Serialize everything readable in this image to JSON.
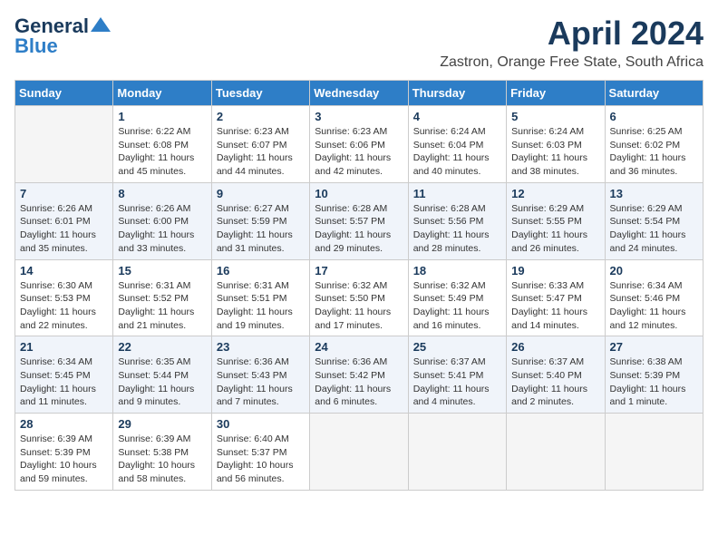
{
  "logo": {
    "general": "General",
    "blue": "Blue"
  },
  "title": "April 2024",
  "location": "Zastron, Orange Free State, South Africa",
  "weekdays": [
    "Sunday",
    "Monday",
    "Tuesday",
    "Wednesday",
    "Thursday",
    "Friday",
    "Saturday"
  ],
  "weeks": [
    [
      {
        "day": "",
        "info": ""
      },
      {
        "day": "1",
        "info": "Sunrise: 6:22 AM\nSunset: 6:08 PM\nDaylight: 11 hours and 45 minutes."
      },
      {
        "day": "2",
        "info": "Sunrise: 6:23 AM\nSunset: 6:07 PM\nDaylight: 11 hours and 44 minutes."
      },
      {
        "day": "3",
        "info": "Sunrise: 6:23 AM\nSunset: 6:06 PM\nDaylight: 11 hours and 42 minutes."
      },
      {
        "day": "4",
        "info": "Sunrise: 6:24 AM\nSunset: 6:04 PM\nDaylight: 11 hours and 40 minutes."
      },
      {
        "day": "5",
        "info": "Sunrise: 6:24 AM\nSunset: 6:03 PM\nDaylight: 11 hours and 38 minutes."
      },
      {
        "day": "6",
        "info": "Sunrise: 6:25 AM\nSunset: 6:02 PM\nDaylight: 11 hours and 36 minutes."
      }
    ],
    [
      {
        "day": "7",
        "info": "Sunrise: 6:26 AM\nSunset: 6:01 PM\nDaylight: 11 hours and 35 minutes."
      },
      {
        "day": "8",
        "info": "Sunrise: 6:26 AM\nSunset: 6:00 PM\nDaylight: 11 hours and 33 minutes."
      },
      {
        "day": "9",
        "info": "Sunrise: 6:27 AM\nSunset: 5:59 PM\nDaylight: 11 hours and 31 minutes."
      },
      {
        "day": "10",
        "info": "Sunrise: 6:28 AM\nSunset: 5:57 PM\nDaylight: 11 hours and 29 minutes."
      },
      {
        "day": "11",
        "info": "Sunrise: 6:28 AM\nSunset: 5:56 PM\nDaylight: 11 hours and 28 minutes."
      },
      {
        "day": "12",
        "info": "Sunrise: 6:29 AM\nSunset: 5:55 PM\nDaylight: 11 hours and 26 minutes."
      },
      {
        "day": "13",
        "info": "Sunrise: 6:29 AM\nSunset: 5:54 PM\nDaylight: 11 hours and 24 minutes."
      }
    ],
    [
      {
        "day": "14",
        "info": "Sunrise: 6:30 AM\nSunset: 5:53 PM\nDaylight: 11 hours and 22 minutes."
      },
      {
        "day": "15",
        "info": "Sunrise: 6:31 AM\nSunset: 5:52 PM\nDaylight: 11 hours and 21 minutes."
      },
      {
        "day": "16",
        "info": "Sunrise: 6:31 AM\nSunset: 5:51 PM\nDaylight: 11 hours and 19 minutes."
      },
      {
        "day": "17",
        "info": "Sunrise: 6:32 AM\nSunset: 5:50 PM\nDaylight: 11 hours and 17 minutes."
      },
      {
        "day": "18",
        "info": "Sunrise: 6:32 AM\nSunset: 5:49 PM\nDaylight: 11 hours and 16 minutes."
      },
      {
        "day": "19",
        "info": "Sunrise: 6:33 AM\nSunset: 5:47 PM\nDaylight: 11 hours and 14 minutes."
      },
      {
        "day": "20",
        "info": "Sunrise: 6:34 AM\nSunset: 5:46 PM\nDaylight: 11 hours and 12 minutes."
      }
    ],
    [
      {
        "day": "21",
        "info": "Sunrise: 6:34 AM\nSunset: 5:45 PM\nDaylight: 11 hours and 11 minutes."
      },
      {
        "day": "22",
        "info": "Sunrise: 6:35 AM\nSunset: 5:44 PM\nDaylight: 11 hours and 9 minutes."
      },
      {
        "day": "23",
        "info": "Sunrise: 6:36 AM\nSunset: 5:43 PM\nDaylight: 11 hours and 7 minutes."
      },
      {
        "day": "24",
        "info": "Sunrise: 6:36 AM\nSunset: 5:42 PM\nDaylight: 11 hours and 6 minutes."
      },
      {
        "day": "25",
        "info": "Sunrise: 6:37 AM\nSunset: 5:41 PM\nDaylight: 11 hours and 4 minutes."
      },
      {
        "day": "26",
        "info": "Sunrise: 6:37 AM\nSunset: 5:40 PM\nDaylight: 11 hours and 2 minutes."
      },
      {
        "day": "27",
        "info": "Sunrise: 6:38 AM\nSunset: 5:39 PM\nDaylight: 11 hours and 1 minute."
      }
    ],
    [
      {
        "day": "28",
        "info": "Sunrise: 6:39 AM\nSunset: 5:39 PM\nDaylight: 10 hours and 59 minutes."
      },
      {
        "day": "29",
        "info": "Sunrise: 6:39 AM\nSunset: 5:38 PM\nDaylight: 10 hours and 58 minutes."
      },
      {
        "day": "30",
        "info": "Sunrise: 6:40 AM\nSunset: 5:37 PM\nDaylight: 10 hours and 56 minutes."
      },
      {
        "day": "",
        "info": ""
      },
      {
        "day": "",
        "info": ""
      },
      {
        "day": "",
        "info": ""
      },
      {
        "day": "",
        "info": ""
      }
    ]
  ]
}
